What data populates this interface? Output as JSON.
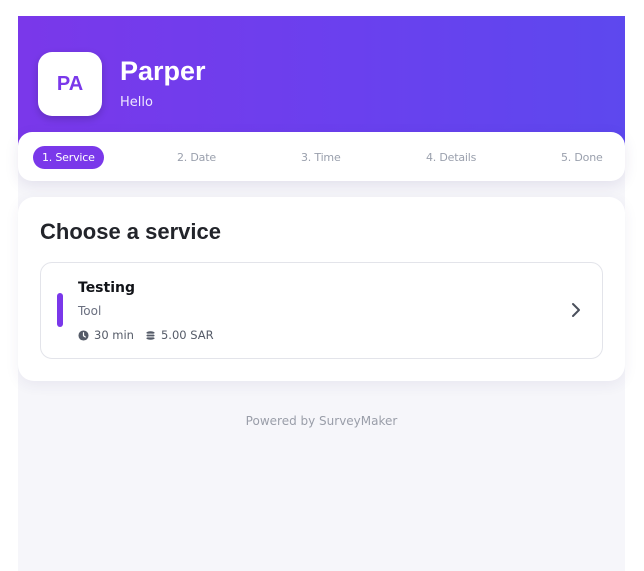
{
  "header": {
    "avatar_initials": "PA",
    "title": "Parper",
    "subtitle": "Hello"
  },
  "steps": [
    {
      "label": "1. Service",
      "active": true
    },
    {
      "label": "2. Date",
      "active": false
    },
    {
      "label": "3. Time",
      "active": false
    },
    {
      "label": "4. Details",
      "active": false
    },
    {
      "label": "5. Done",
      "active": false
    }
  ],
  "main": {
    "title": "Choose a service",
    "services": [
      {
        "name": "Testing",
        "category": "Tool",
        "duration": "30 min",
        "price": "5.00 SAR",
        "duration_icon": "clock-icon",
        "price_icon": "coins-icon",
        "action_icon": "chevron-right-icon"
      }
    ]
  },
  "footer": {
    "powered_by": "Powered by SurveyMaker"
  },
  "colors": {
    "accent": "#7a38ea",
    "header_gradient_start": "#7a38ea",
    "header_gradient_end": "#5d48ee",
    "background": "#f6f6fa"
  }
}
